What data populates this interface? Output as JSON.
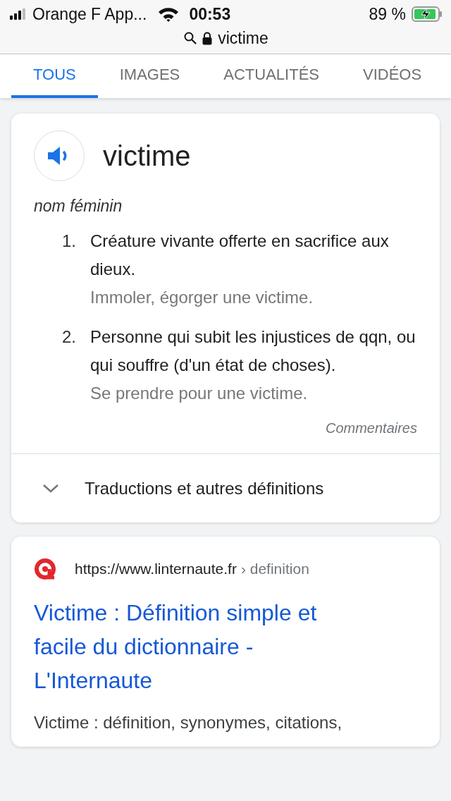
{
  "status_bar": {
    "carrier": "Orange F App...",
    "time": "00:53",
    "battery": "89 %"
  },
  "address_bar": {
    "url": "victime"
  },
  "tabs": [
    {
      "label": "TOUS",
      "selected": true
    },
    {
      "label": "IMAGES",
      "selected": false
    },
    {
      "label": "ACTUALITÉS",
      "selected": false
    },
    {
      "label": "VIDÉOS",
      "selected": false
    }
  ],
  "dictionary": {
    "word": "victime",
    "part_of_speech": "nom féminin",
    "senses": [
      {
        "number": "1.",
        "definition": "Créature vivante offerte en sacrifice aux dieux.",
        "example": "Immoler, égorger une victime."
      },
      {
        "number": "2.",
        "definition": "Personne qui subit les injustices de qqn, ou qui souffre (d'un état de choses).",
        "example": "Se prendre pour une victime."
      }
    ],
    "feedback": "Commentaires",
    "more": "Traductions et autres définitions"
  },
  "result": {
    "url": "https://www.linternaute.fr",
    "breadcrumb": "› definition",
    "title": "Victime : Définition simple et facile du dictionnaire - L'Internaute",
    "snippet": "Victime : définition, synonymes, citations,"
  }
}
